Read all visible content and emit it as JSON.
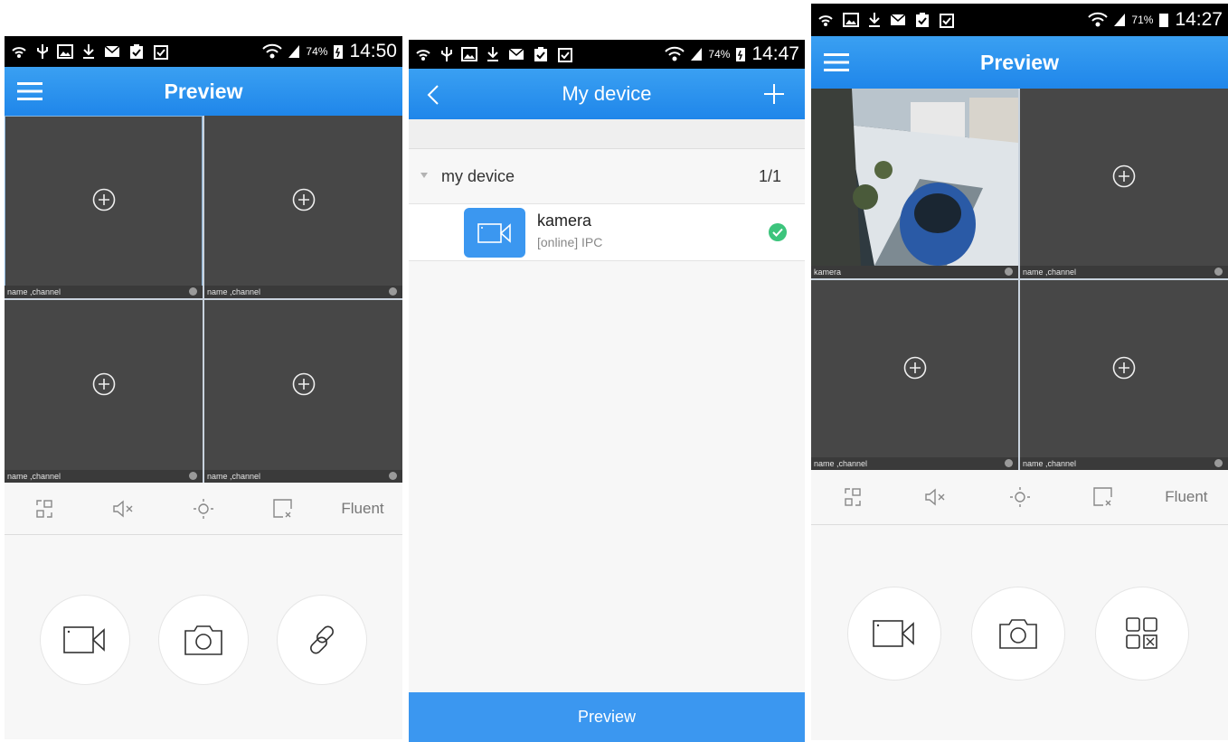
{
  "screen1": {
    "status_bar": {
      "battery_percent": "74%",
      "time": "14:50"
    },
    "title": "Preview",
    "cells": [
      {
        "label": "name ,channel"
      },
      {
        "label": "name ,channel"
      },
      {
        "label": "name ,channel"
      },
      {
        "label": "name ,channel"
      }
    ],
    "toolbar": {
      "stream_label": "Fluent"
    },
    "icons": [
      "fullscreen-icon",
      "mute-icon",
      "ptz-icon",
      "close-window-icon",
      "record-icon",
      "camera-icon",
      "link-icon"
    ]
  },
  "screen2": {
    "status_bar": {
      "battery_percent": "74%",
      "time": "14:47"
    },
    "title": "My device",
    "group": {
      "name": "my device",
      "count": "1/1"
    },
    "device": {
      "name": "kamera",
      "status": "[online] IPC"
    },
    "preview_button": "Preview"
  },
  "screen3": {
    "status_bar": {
      "battery_percent": "71%",
      "time": "14:27"
    },
    "title": "Preview",
    "cells": [
      {
        "label": "kamera"
      },
      {
        "label": "name ,channel"
      },
      {
        "label": "name ,channel"
      },
      {
        "label": "name ,channel"
      }
    ],
    "toolbar": {
      "stream_label": "Fluent"
    }
  },
  "colors": {
    "accent": "#2a8ff0",
    "tile": "#474747",
    "online": "#3cc47c"
  }
}
